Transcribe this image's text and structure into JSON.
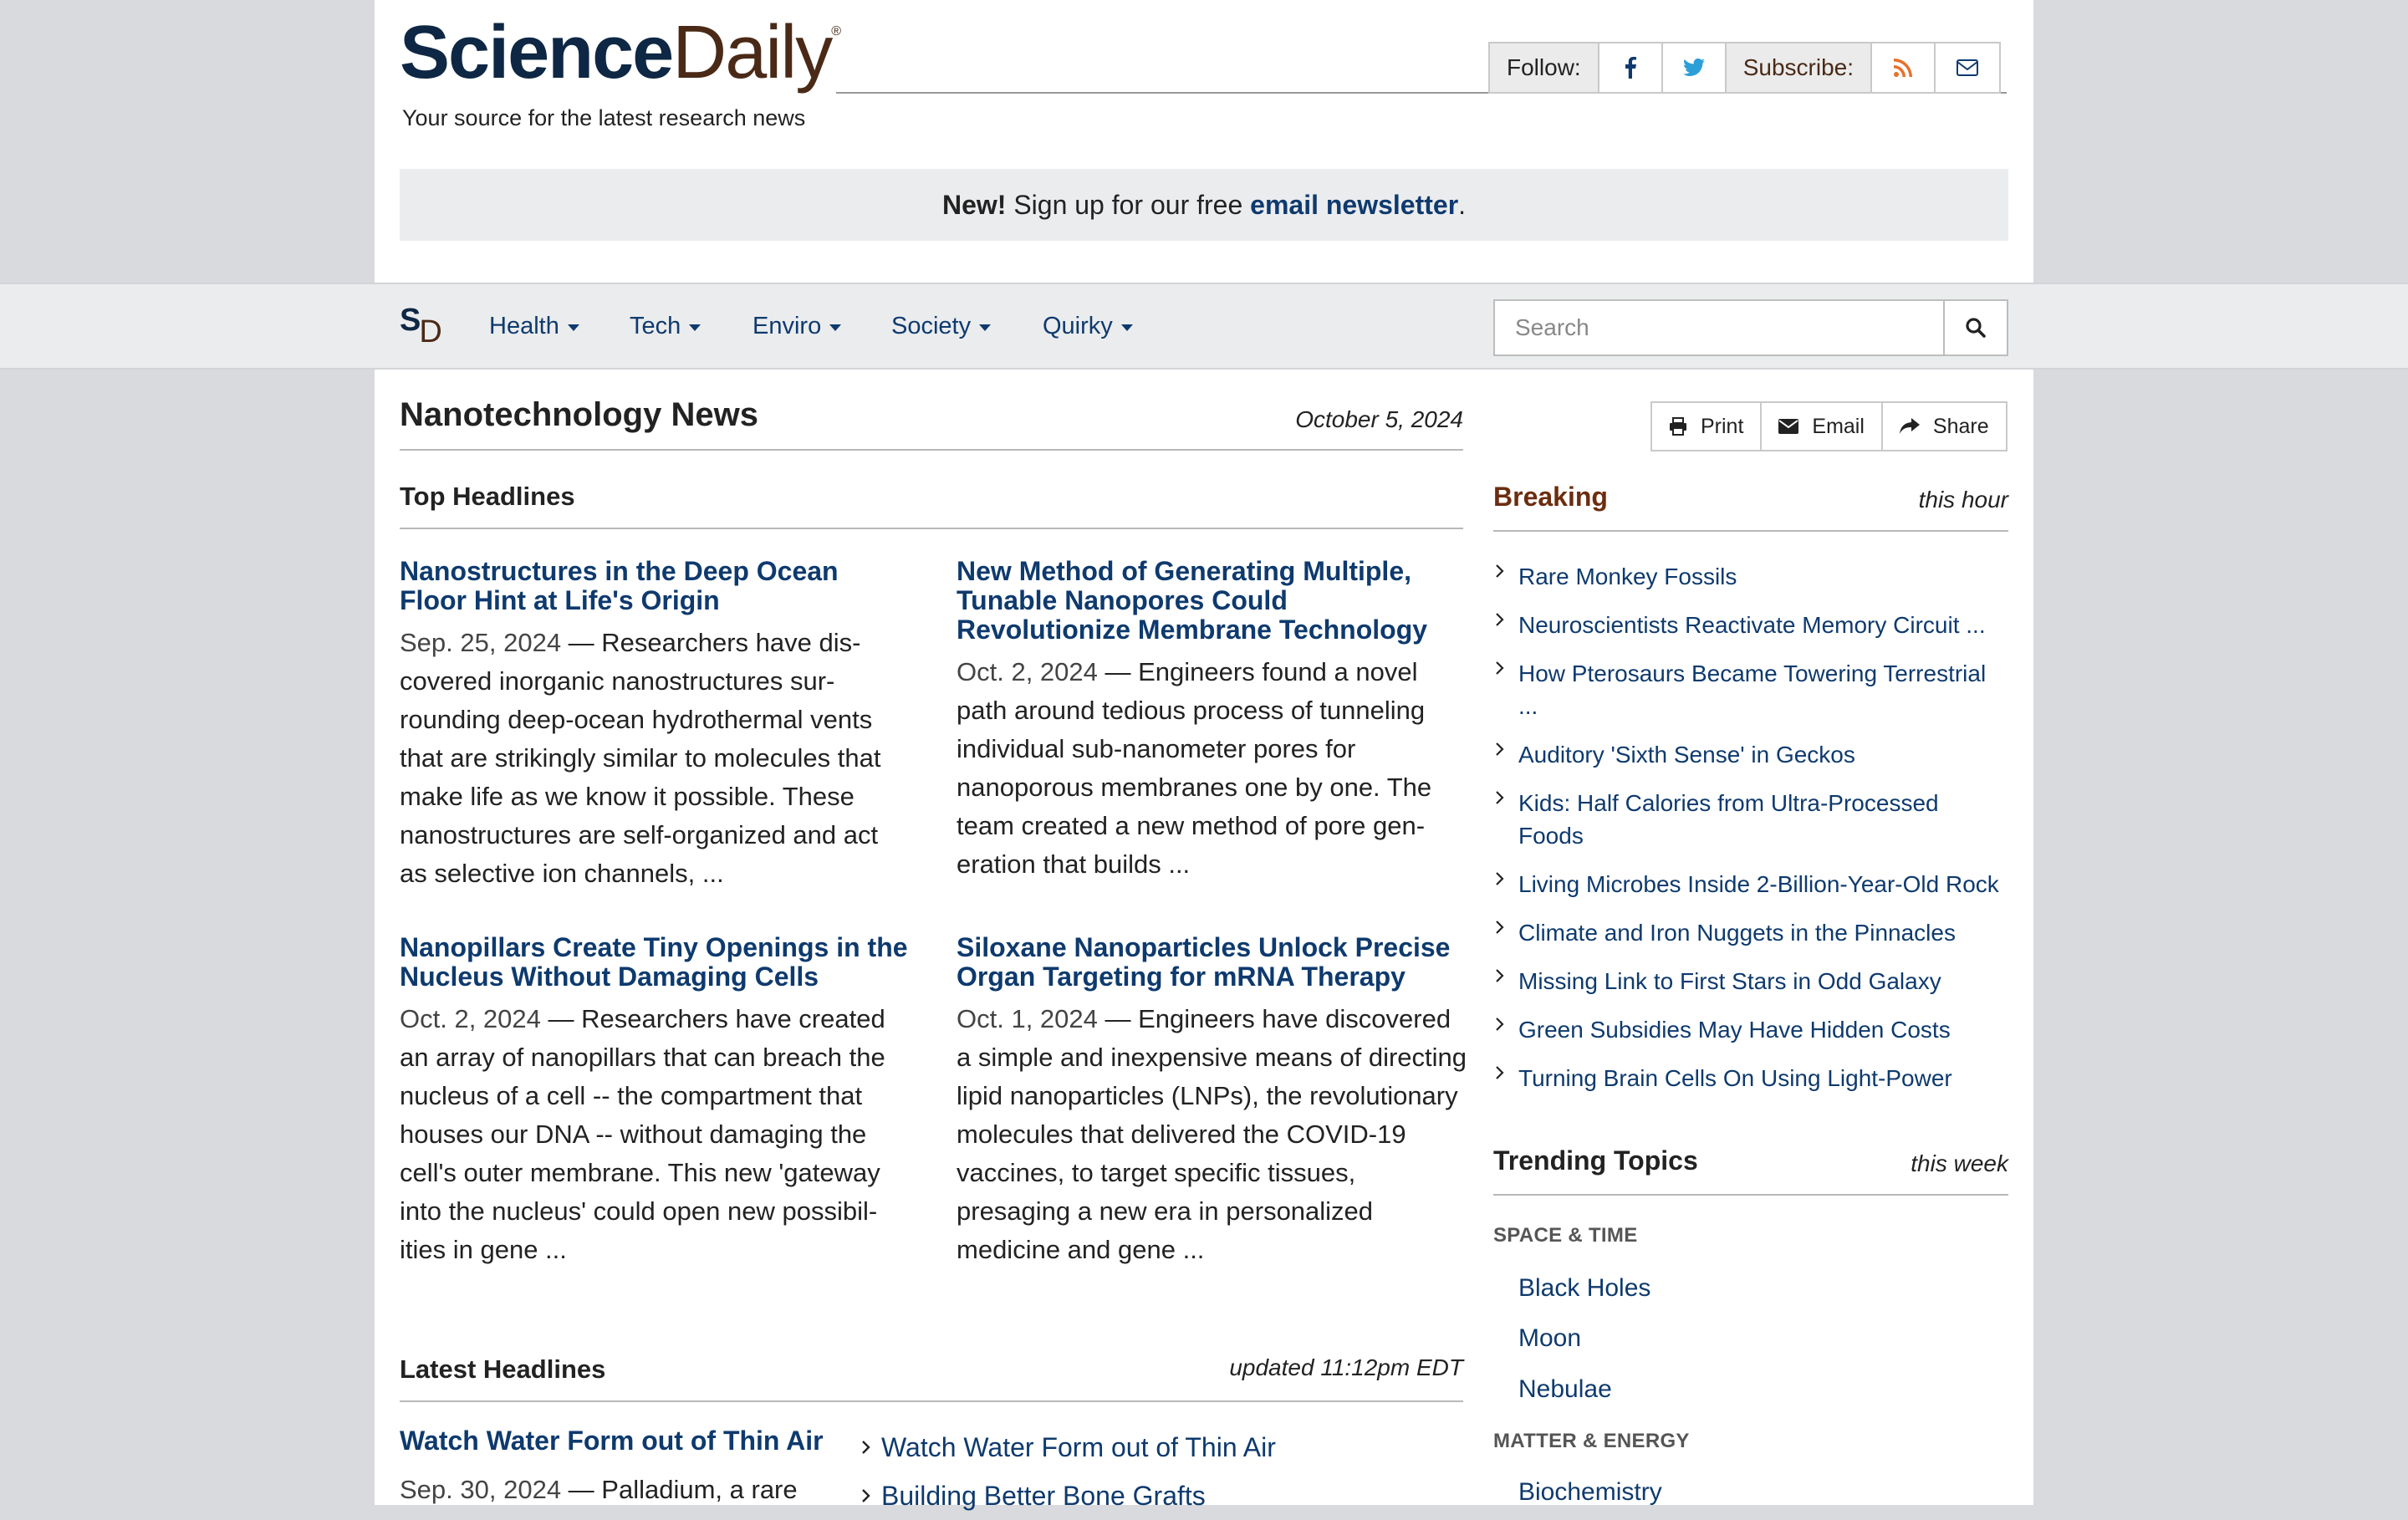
{
  "header": {
    "logo_science": "Science",
    "logo_daily": "Daily",
    "logo_reg": "®",
    "tagline": "Your source for the latest research news",
    "follow_label": "Follow:",
    "subscribe_label": "Subscribe:"
  },
  "newsletter": {
    "new": "New!",
    "text": " Sign up for our free ",
    "link": "email newsletter",
    "end": "."
  },
  "nav": {
    "logo_s": "S",
    "logo_d": "D",
    "items": [
      "Health",
      "Tech",
      "Enviro",
      "Society",
      "Quirky"
    ],
    "search_placeholder": "Search"
  },
  "page": {
    "title": "Nanotechnology News",
    "date": "October 5, 2024"
  },
  "top_headlines": {
    "heading": "Top Headlines",
    "stories": [
      {
        "title": "Nanostructures in the Deep Ocean Floor Hint at Life's Origin",
        "date": "Sep. 25, 2024",
        "summary": " — Researchers have dis­covered inorganic nanostructures sur­rounding deep-ocean hydrothermal vents that are strikingly similar to molecules that make life as we know it possible. These nanostructures are self-organized and act as selective ion channels, ..."
      },
      {
        "title": "New Method of Generating Multiple, Tunable Nanopores Could Revolutionize Membrane Technology",
        "date": "Oct. 2, 2024",
        "summary": " — Engineers found a novel path around tedious process of tunneling individual sub-nanometer pores for nanoporous membranes one by one. The team created a new method of pore gen­eration that builds ..."
      },
      {
        "title": "Nanopillars Create Tiny Openings in the Nucleus Without Damaging Cells",
        "date": "Oct. 2, 2024",
        "summary": " — Researchers have created an array of nanopillars that can breach the nucleus of a cell -- the compartment that houses our DNA -- without damaging the cell's outer membrane. This new 'gateway into the nucleus' could open new possibil­ities in gene ..."
      },
      {
        "title": "Siloxane Nanoparticles Unlock Precise Organ Targeting for mRNA Therapy",
        "date": "Oct. 1, 2024",
        "summary": " — Engineers have discov­ered a simple and inexpensive means of directing lipid nanoparticles (LNPs), the revolutionary molecules that delivered the COVID-19 vaccines, to target specific tis­sues, presaging a new era in personalized medicine and gene ..."
      }
    ]
  },
  "latest": {
    "heading": "Latest Headlines",
    "updated": "updated 11:12pm EDT",
    "first_title": "Watch Water Form out of Thin Air",
    "first_date": "Sep. 30, 2024",
    "first_summary": " — Palladium, a rare",
    "list": [
      "Watch Water Form out of Thin Air",
      "Building Better Bone Grafts"
    ]
  },
  "actions": {
    "print": "Print",
    "email": "Email",
    "share": "Share"
  },
  "breaking": {
    "heading": "Breaking",
    "when": "this hour",
    "items": [
      "Rare Monkey Fossils",
      "Neuroscientists Reactivate Memory Circuit ...",
      "How Pterosaurs Became Towering Terrestrial ...",
      "Auditory 'Sixth Sense' in Geckos",
      "Kids: Half Calories from Ultra-Processed Foods",
      "Living Microbes Inside 2-Billion-Year-Old Rock",
      "Climate and Iron Nuggets in the Pinnacles",
      "Missing Link to First Stars in Odd Galaxy",
      "Green Subsidies May Have Hidden Costs",
      "Turning Brain Cells On Using Light-Power"
    ]
  },
  "trending": {
    "heading": "Trending Topics",
    "when": "this week",
    "cat1": "SPACE & TIME",
    "cat1_topics": [
      "Black Holes",
      "Moon",
      "Nebulae"
    ],
    "cat2": "MATTER & ENERGY",
    "cat2_topics": [
      "Biochemistry"
    ]
  },
  "colors": {
    "navy": "#0e3a6e",
    "brown": "#4a2a17",
    "rss": "#e8702a",
    "twitter": "#2c9fd8"
  }
}
